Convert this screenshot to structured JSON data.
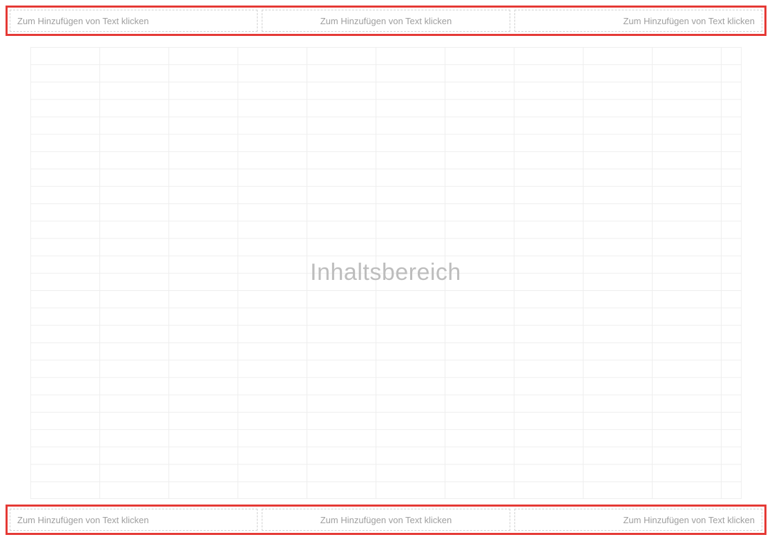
{
  "header": {
    "cells": [
      {
        "text": "Zum Hinzufügen von Text klicken"
      },
      {
        "text": "Zum Hinzufügen von Text klicken"
      },
      {
        "text": "Zum Hinzufügen von Text klicken"
      }
    ]
  },
  "content": {
    "placeholder_label": "Inhaltsbereich"
  },
  "footer": {
    "cells": [
      {
        "text": "Zum Hinzufügen von Text klicken"
      },
      {
        "text": "Zum Hinzufügen von Text klicken"
      },
      {
        "text": "Zum Hinzufügen von Text klicken"
      }
    ]
  }
}
